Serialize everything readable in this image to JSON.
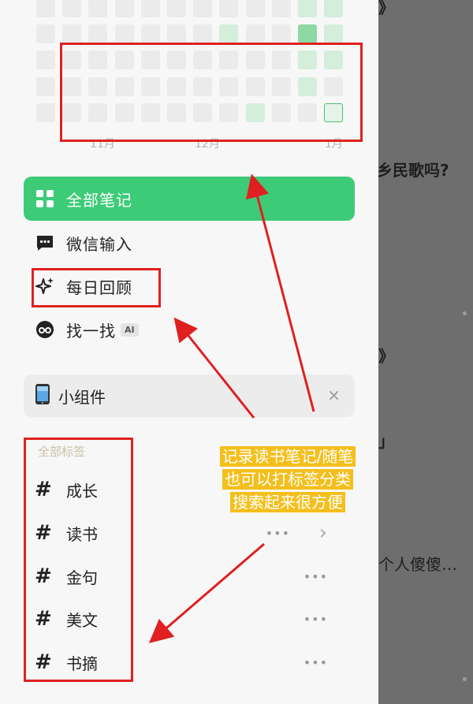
{
  "heatmap": {
    "months": [
      "11月",
      "12月",
      "1月"
    ]
  },
  "menu": [
    {
      "label": "全部笔记",
      "icon": "grid-icon",
      "active": true
    },
    {
      "label": "微信输入",
      "icon": "chat-bubble-icon",
      "active": false
    },
    {
      "label": "每日回顾",
      "icon": "sparkle-icon",
      "active": false
    },
    {
      "label": "找一找",
      "icon": "binoculars-icon",
      "badge": "AI",
      "active": false
    }
  ],
  "widget": {
    "label": "小组件",
    "icon": "phone-icon",
    "close": "×"
  },
  "tags": {
    "title": "全部标签",
    "items": [
      {
        "label": "成长"
      },
      {
        "label": "读书"
      },
      {
        "label": "金句"
      },
      {
        "label": "美文"
      },
      {
        "label": "书摘"
      }
    ],
    "hash": "#",
    "more": "•••",
    "chevron": "›"
  },
  "background": {
    "lines": [
      "乡民歌吗?",
      "》",
      "」",
      "个人傻傻…"
    ],
    "top": "》"
  },
  "annotation": {
    "lines": [
      "记录读书笔记/随笔",
      "也可以打标签分类",
      "搜索起来很方便"
    ]
  },
  "colors": {
    "accent": "#3dcb78",
    "highlight": "#f4bf1c",
    "annotation_red": "#e02020"
  }
}
